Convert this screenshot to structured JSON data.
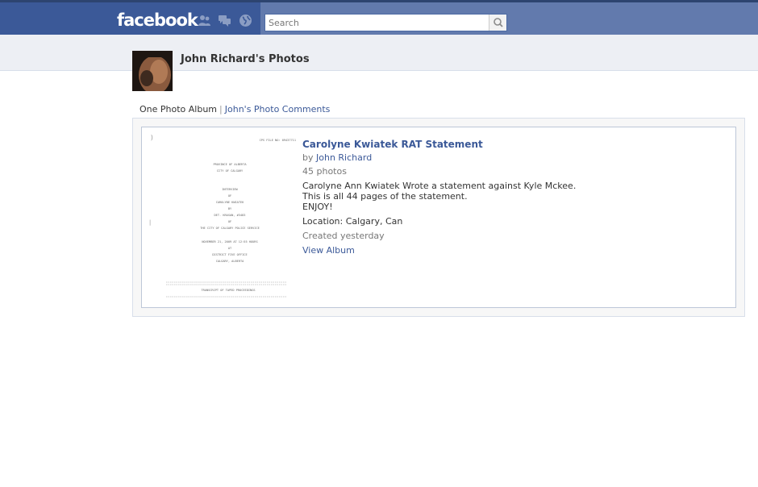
{
  "app": {
    "logo_text": "facebook"
  },
  "search": {
    "placeholder": "Search"
  },
  "icons": {
    "friends": "friend-requests-icon",
    "messages": "messages-icon",
    "notifications": "notifications-globe-icon",
    "search": "magnifier-icon"
  },
  "colors": {
    "brand": "#3b5998",
    "brand_light": "#627aad",
    "band": "#edeff4",
    "link": "#3b5998"
  },
  "header": {
    "title": "John Richard's Photos"
  },
  "subnav": {
    "current": "One Photo Album",
    "separator": "|",
    "comments_link": "John's Photo Comments"
  },
  "album": {
    "title": "Carolyne Kwiatek RAT Statement",
    "by_prefix": "by",
    "owner": "John Richard",
    "count": "45 photos",
    "description_lines": [
      "Carolyne Ann Kwiatek Wrote a statement against Kyle Mckee.",
      "This is all 44 pages of the statement.",
      "ENJOY!"
    ],
    "location": "Location: Calgary, Can",
    "created": "Created yesterday",
    "view_link": "View Album"
  },
  "thumbnail_doc": {
    "file_no": "CPS FILE NO: 09437711",
    "lines": [
      "PROVINCE OF ALBERTA",
      "CITY OF CALGARY",
      "INTERVIEW",
      "OF",
      "CAROLYNE KWIATEK",
      "BY",
      "DET. KRASAN, #3483",
      "OF",
      "THE CITY OF CALGARY POLICE SERVICE",
      "NOVEMBER 21, 2009 AT 12:55 HOURS",
      "AT",
      "DISTRICT FIVE OFFICE",
      "CALGARY, ALBERTA"
    ],
    "footer": "TRANSCRIPT OF TAPED PROCEEDINGS"
  }
}
